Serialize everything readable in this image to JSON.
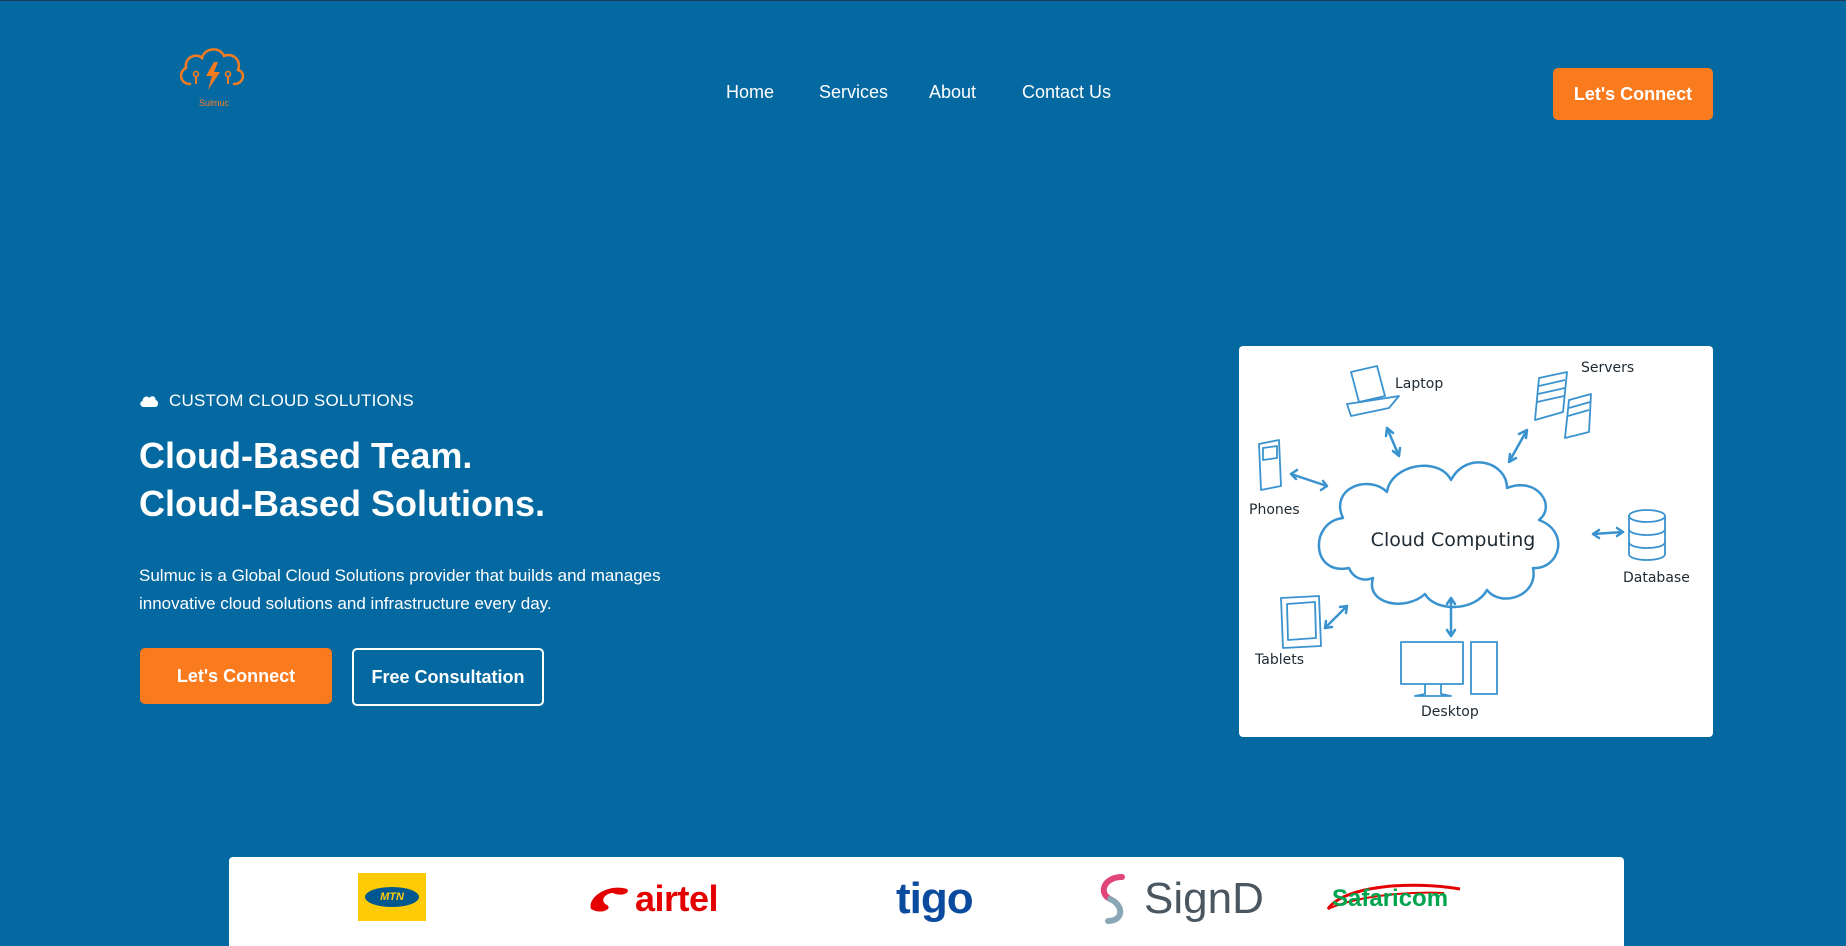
{
  "header": {
    "logo_text": "Sulmuc",
    "nav": [
      {
        "label": "Home"
      },
      {
        "label": "Services"
      },
      {
        "label": "About"
      },
      {
        "label": "Contact Us"
      }
    ],
    "cta_label": "Let's Connect"
  },
  "hero": {
    "eyebrow": "CUSTOM CLOUD SOLUTIONS",
    "eyebrow_icon": "cloud-icon",
    "title_line1": "Cloud-Based Team.",
    "title_line2": "Cloud-Based Solutions.",
    "description": "Sulmuc is a Global Cloud Solutions provider that builds and manages innovative cloud solutions and infrastructure every day.",
    "primary_button": "Let's Connect",
    "secondary_button": "Free Consultation"
  },
  "diagram": {
    "center": "Cloud Computing",
    "nodes": [
      "Laptop",
      "Servers",
      "Phones",
      "Database",
      "Tablets",
      "Desktop"
    ]
  },
  "partners": [
    {
      "name": "MTN"
    },
    {
      "name": "airtel"
    },
    {
      "name": "tigo"
    },
    {
      "name": "SignD"
    },
    {
      "name": "Safaricom"
    }
  ],
  "colors": {
    "background": "#0569a1",
    "accent": "#fa7b1e",
    "diagram_line": "#3a93cf"
  }
}
